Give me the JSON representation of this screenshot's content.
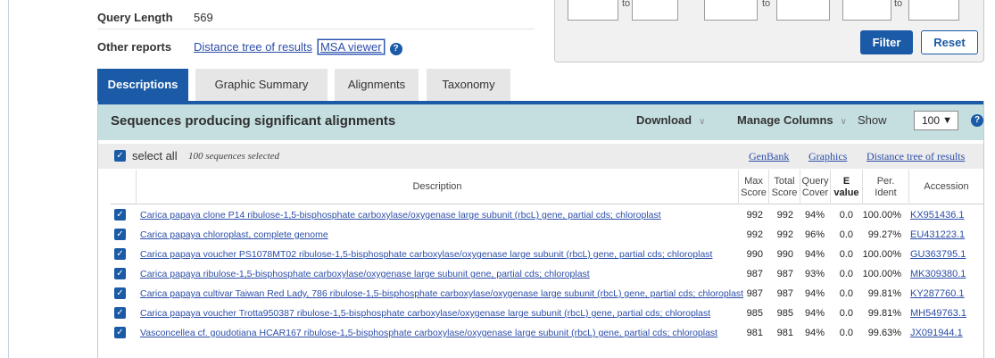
{
  "info": {
    "query_length_label": "Query Length",
    "query_length_value": "569",
    "other_reports_label": "Other reports",
    "distance_tree_link": "Distance tree of results",
    "msa_viewer_link": "MSA viewer",
    "help_icon": "?"
  },
  "filter": {
    "to_label": "to",
    "filter_button": "Filter",
    "reset_button": "Reset"
  },
  "tabs": [
    {
      "label": "Descriptions",
      "active": true
    },
    {
      "label": "Graphic Summary",
      "active": false
    },
    {
      "label": "Alignments",
      "active": false
    },
    {
      "label": "Taxonomy",
      "active": false
    }
  ],
  "results": {
    "title": "Sequences producing significant alignments",
    "download": "Download",
    "manage_columns": "Manage Columns",
    "show_label": "Show",
    "show_value": "100",
    "help_icon": "?",
    "select_all": "select all",
    "selected_note": "100 sequences selected",
    "links": [
      "GenBank",
      "Graphics",
      "Distance tree of results"
    ]
  },
  "columns": {
    "description": "Description",
    "max_score": [
      "Max",
      "Score"
    ],
    "total_score": [
      "Total",
      "Score"
    ],
    "query_cover": [
      "Query",
      "Cover"
    ],
    "e_value": [
      "E",
      "value"
    ],
    "per_ident": [
      "Per.",
      "Ident"
    ],
    "accession": "Accession"
  },
  "rows": [
    {
      "description": "Carica papaya clone P14 ribulose-1,5-bisphosphate carboxylase/oxygenase large subunit (rbcL) gene, partial cds; chloroplast",
      "max": "992",
      "total": "992",
      "cover": "94%",
      "evalue": "0.0",
      "ident": "100.00%",
      "accession": "KX951436.1"
    },
    {
      "description": "Carica papaya chloroplast, complete genome",
      "max": "992",
      "total": "992",
      "cover": "96%",
      "evalue": "0.0",
      "ident": "99.27%",
      "accession": "EU431223.1"
    },
    {
      "description": "Carica papaya voucher PS1078MT02 ribulose-1,5-bisphosphate carboxylase/oxygenase large subunit (rbcL) gene, partial cds; chloroplast",
      "max": "990",
      "total": "990",
      "cover": "94%",
      "evalue": "0.0",
      "ident": "100.00%",
      "accession": "GU363795.1"
    },
    {
      "description": "Carica papaya ribulose-1,5-bisphosphate carboxylase/oxygenase large subunit gene, partial cds; chloroplast",
      "max": "987",
      "total": "987",
      "cover": "93%",
      "evalue": "0.0",
      "ident": "100.00%",
      "accession": "MK309380.1"
    },
    {
      "description": "Carica papaya cultivar Taiwan Red Lady, 786 ribulose-1,5-bisphosphate carboxylase/oxygenase large subunit (rbcL) gene, partial cds; chloroplast",
      "max": "987",
      "total": "987",
      "cover": "94%",
      "evalue": "0.0",
      "ident": "99.81%",
      "accession": "KY287760.1"
    },
    {
      "description": "Carica papaya voucher Trotta950387 ribulose-1,5-bisphosphate carboxylase/oxygenase large subunit (rbcL) gene, partial cds; chloroplast",
      "max": "985",
      "total": "985",
      "cover": "94%",
      "evalue": "0.0",
      "ident": "99.81%",
      "accession": "MH549763.1"
    },
    {
      "description": "Vasconcellea cf. goudotiana HCAR167 ribulose-1,5-bisphosphate carboxylase/oxygenase large subunit (rbcL) gene, partial cds; chloroplast",
      "max": "981",
      "total": "981",
      "cover": "94%",
      "evalue": "0.0",
      "ident": "99.63%",
      "accession": "JX091944.1"
    }
  ]
}
